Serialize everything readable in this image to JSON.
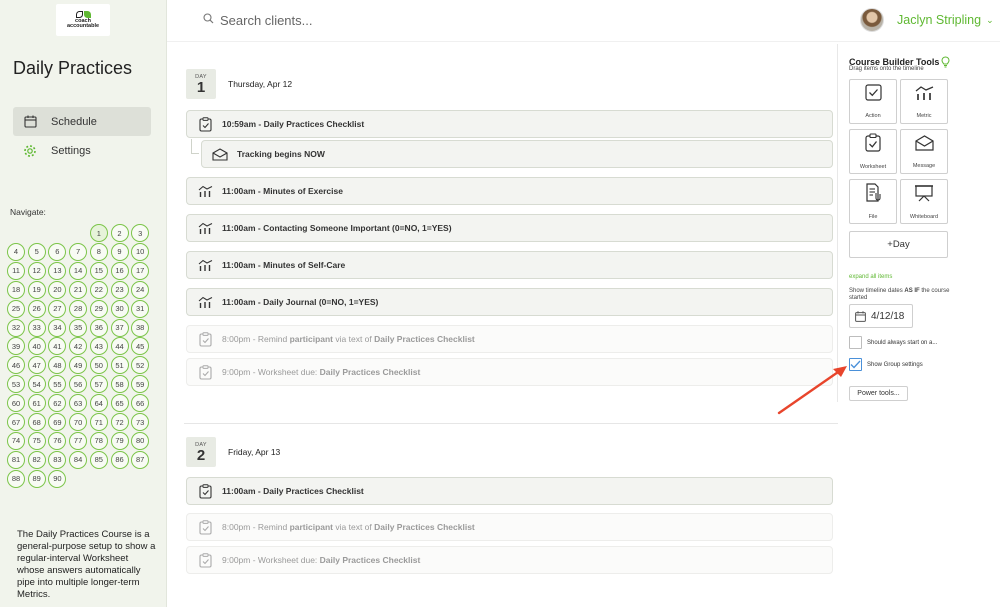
{
  "app": {
    "logo_line1": "coach",
    "logo_line2": "accountable",
    "brand_color": "#5fb832"
  },
  "sidebar": {
    "course_title": "Daily Practices",
    "nav": [
      {
        "label": "Schedule",
        "icon": "calendar-icon",
        "active": true
      },
      {
        "label": "Settings",
        "icon": "gear-icon",
        "active": false
      }
    ],
    "navigate_label": "Navigate:",
    "days": [
      "1",
      "2",
      "3",
      "4",
      "5",
      "6",
      "7",
      "8",
      "9",
      "10",
      "11",
      "12",
      "13",
      "14",
      "15",
      "16",
      "17",
      "18",
      "19",
      "20",
      "21",
      "22",
      "23",
      "24",
      "25",
      "26",
      "27",
      "28",
      "29",
      "30",
      "31",
      "32",
      "33",
      "34",
      "35",
      "36",
      "37",
      "38",
      "39",
      "40",
      "41",
      "42",
      "43",
      "44",
      "45",
      "46",
      "47",
      "48",
      "49",
      "50",
      "51",
      "52",
      "53",
      "54",
      "55",
      "56",
      "57",
      "58",
      "59",
      "60",
      "61",
      "62",
      "63",
      "64",
      "65",
      "66",
      "67",
      "68",
      "69",
      "70",
      "71",
      "72",
      "73",
      "74",
      "75",
      "76",
      "77",
      "78",
      "79",
      "80",
      "81",
      "82",
      "83",
      "84",
      "85",
      "86",
      "87",
      "88",
      "89",
      "90"
    ],
    "description": "The Daily Practices Course is a general-purpose setup to show a regular-interval Worksheet whose answers automatically pipe into multiple longer-term Metrics."
  },
  "header": {
    "search_placeholder": "Search clients...",
    "user_name": "Jaclyn Stripling",
    "user_caret": "⌄"
  },
  "timeline": {
    "day_label": "DAY",
    "days": [
      {
        "number": "1",
        "date": "Thursday, Apr 12",
        "items": [
          {
            "text": "10:59am - Daily Practices Checklist",
            "icon": "worksheet-icon",
            "style": "normal"
          },
          {
            "text": "Tracking begins NOW",
            "icon": "message-icon",
            "style": "sub"
          },
          {
            "text": "11:00am - Minutes of Exercise",
            "icon": "metric-icon",
            "style": "normal"
          },
          {
            "text": "11:00am - Contacting Someone Important (0=NO, 1=YES)",
            "icon": "metric-icon",
            "style": "normal"
          },
          {
            "text": "11:00am - Minutes of Self-Care",
            "icon": "metric-icon",
            "style": "normal"
          },
          {
            "text": "11:00am - Daily Journal (0=NO, 1=YES)",
            "icon": "metric-icon",
            "style": "normal"
          },
          {
            "pre": "8:00pm - Remind ",
            "bold1": "participant",
            "mid": " via text of ",
            "bold2": "Daily Practices Checklist",
            "icon": "worksheet-icon",
            "style": "muted"
          },
          {
            "pre": "9:00pm - Worksheet due: ",
            "bold1": "Daily Practices Checklist",
            "icon": "worksheet-icon",
            "style": "muted"
          }
        ]
      },
      {
        "number": "2",
        "date": "Friday, Apr 13",
        "items": [
          {
            "text": "11:00am - Daily Practices Checklist",
            "icon": "worksheet-icon",
            "style": "normal"
          },
          {
            "pre": "8:00pm - Remind ",
            "bold1": "participant",
            "mid": " via text of ",
            "bold2": "Daily Practices Checklist",
            "icon": "worksheet-icon",
            "style": "muted"
          },
          {
            "pre": "9:00pm - Worksheet due: ",
            "bold1": "Daily Practices Checklist",
            "icon": "worksheet-icon",
            "style": "muted"
          }
        ]
      }
    ]
  },
  "tools": {
    "title": "Course Builder Tools",
    "subtitle": "Drag items onto the timeline",
    "buttons": [
      {
        "label": "Action",
        "icon": "action-icon"
      },
      {
        "label": "Metric",
        "icon": "metric-icon"
      },
      {
        "label": "Worksheet",
        "icon": "worksheet-icon"
      },
      {
        "label": "Message",
        "icon": "message-icon"
      },
      {
        "label": "File",
        "icon": "file-icon"
      },
      {
        "label": "Whiteboard",
        "icon": "whiteboard-icon"
      }
    ],
    "add_day": "+Day",
    "expand_all": "expand all items",
    "asif_pre": "Show timeline dates ",
    "asif_bold": "AS IF",
    "asif_post": " the course started",
    "start_date": "4/12/18",
    "should_start": "Should always start on a...",
    "should_start_checked": false,
    "show_group": "Show Group settings",
    "show_group_checked": true,
    "power_tools": "Power tools..."
  },
  "annotation": {
    "arrow_color": "#e8452c"
  }
}
